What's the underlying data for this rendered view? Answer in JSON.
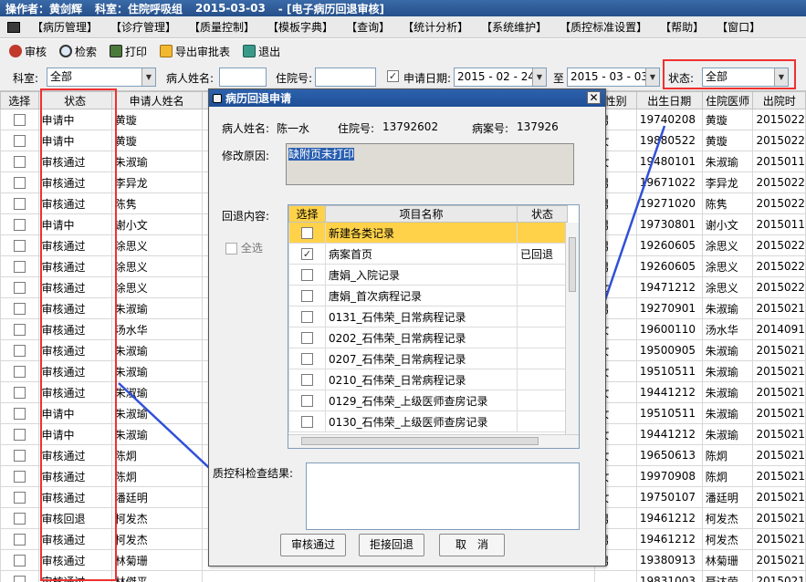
{
  "titlebar": {
    "operator": "操作者：黄剑辉",
    "department": "科室：住院呼吸组",
    "date": "2015-03-03",
    "window": "- [电子病历回退审核]"
  },
  "menu": [
    "【病历管理】",
    "【诊疗管理】",
    "【质量控制】",
    "【模板字典】",
    "【查询】",
    "【统计分析】",
    "【系统维护】",
    "【质控标准设置】",
    "【帮助】",
    "【窗口】"
  ],
  "toolbar": {
    "audit": "审核",
    "search": "检索",
    "print": "打印",
    "export": "导出审批表",
    "exit": "退出"
  },
  "filters": {
    "dept_label": "科室:",
    "dept_value": "全部",
    "patient_label": "病人姓名:",
    "patient_value": "",
    "admission_label": "住院号:",
    "admission_value": "",
    "date_label": "申请日期:",
    "date_from": "2015 - 02 - 24",
    "date_to_label": "至",
    "date_to": "2015 - 03 - 03",
    "status_label": "状态:",
    "status_value": "全部"
  },
  "grid": {
    "headers": [
      "选择",
      "状态",
      "申请人姓名",
      "性别",
      "出生日期",
      "住院医师",
      "出院时"
    ],
    "rows": [
      {
        "status": "申请中",
        "applicant": "黄璇",
        "sex": "男",
        "dob": "19740208",
        "doctor": "黄璇",
        "discharge": "2015022"
      },
      {
        "status": "申请中",
        "applicant": "黄璇",
        "sex": "女",
        "dob": "19880522",
        "doctor": "黄璇",
        "discharge": "2015022"
      },
      {
        "status": "审核通过",
        "applicant": "朱淑瑜",
        "sex": "女",
        "dob": "19480101",
        "doctor": "朱淑瑜",
        "discharge": "2015011"
      },
      {
        "status": "审核通过",
        "applicant": "李异龙",
        "sex": "男",
        "dob": "19671022",
        "doctor": "李异龙",
        "discharge": "2015022"
      },
      {
        "status": "审核通过",
        "applicant": "陈隽",
        "sex": "男",
        "dob": "19271020",
        "doctor": "陈隽",
        "discharge": "2015022"
      },
      {
        "status": "申请中",
        "applicant": "谢小文",
        "sex": "男",
        "dob": "19730801",
        "doctor": "谢小文",
        "discharge": "2015011"
      },
      {
        "status": "审核通过",
        "applicant": "涂思义",
        "sex": "男",
        "dob": "19260605",
        "doctor": "涂思义",
        "discharge": "2015022"
      },
      {
        "status": "审核通过",
        "applicant": "涂思义",
        "sex": "男",
        "dob": "19260605",
        "doctor": "涂思义",
        "discharge": "2015022"
      },
      {
        "status": "审核通过",
        "applicant": "涂思义",
        "sex": "女",
        "dob": "19471212",
        "doctor": "涂思义",
        "discharge": "2015022"
      },
      {
        "status": "审核通过",
        "applicant": "朱淑瑜",
        "sex": "男",
        "dob": "19270901",
        "doctor": "朱淑瑜",
        "discharge": "2015021"
      },
      {
        "status": "审核通过",
        "applicant": "汤水华",
        "sex": "女",
        "dob": "19600110",
        "doctor": "汤水华",
        "discharge": "2014091"
      },
      {
        "status": "审核通过",
        "applicant": "朱淑瑜",
        "sex": "女",
        "dob": "19500905",
        "doctor": "朱淑瑜",
        "discharge": "2015021"
      },
      {
        "status": "审核通过",
        "applicant": "朱淑瑜",
        "sex": "女",
        "dob": "19510511",
        "doctor": "朱淑瑜",
        "discharge": "2015021"
      },
      {
        "status": "审核通过",
        "applicant": "朱淑瑜",
        "sex": "女",
        "dob": "19441212",
        "doctor": "朱淑瑜",
        "discharge": "2015021"
      },
      {
        "status": "申请中",
        "applicant": "朱淑瑜",
        "sex": "女",
        "dob": "19510511",
        "doctor": "朱淑瑜",
        "discharge": "2015021"
      },
      {
        "status": "申请中",
        "applicant": "朱淑瑜",
        "sex": "女",
        "dob": "19441212",
        "doctor": "朱淑瑜",
        "discharge": "2015021"
      },
      {
        "status": "审核通过",
        "applicant": "陈炯",
        "sex": "女",
        "dob": "19650613",
        "doctor": "陈炯",
        "discharge": "2015021"
      },
      {
        "status": "审核通过",
        "applicant": "陈炯",
        "sex": "女",
        "dob": "19970908",
        "doctor": "陈炯",
        "discharge": "2015021"
      },
      {
        "status": "审核通过",
        "applicant": "潘廷明",
        "sex": "女",
        "dob": "19750107",
        "doctor": "潘廷明",
        "discharge": "2015021"
      },
      {
        "status": "审核回退",
        "applicant": "柯发杰",
        "sex": "男",
        "dob": "19461212",
        "doctor": "柯发杰",
        "discharge": "2015021"
      },
      {
        "status": "审核通过",
        "applicant": "柯发杰",
        "sex": "男",
        "dob": "19461212",
        "doctor": "柯发杰",
        "discharge": "2015021"
      },
      {
        "status": "审核通过",
        "applicant": "林菊珊",
        "sex": "男",
        "dob": "19380913",
        "doctor": "林菊珊",
        "discharge": "2015021"
      },
      {
        "status": "审核通过",
        "applicant": "林傑平",
        "sex": "",
        "dob": "19831003",
        "doctor": "聂达荣",
        "discharge": "2015021"
      }
    ]
  },
  "dialog": {
    "title": "病历回退申请",
    "patient_label": "病人姓名:",
    "patient_name": "陈一水",
    "admission_label": "住院号:",
    "admission_no": "13792602",
    "case_label": "病案号:",
    "case_no": "137926",
    "reason_label": "修改原因:",
    "reason_text": "缺附页未打印",
    "content_label": "回退内容:",
    "select_all": "全选",
    "item_headers": [
      "选择",
      "项目名称",
      "状态"
    ],
    "items": [
      {
        "name": "新建各类记录",
        "checked": false,
        "status": ""
      },
      {
        "name": "病案首页",
        "checked": true,
        "status": "已回退"
      },
      {
        "name": "唐娟_入院记录",
        "checked": false,
        "status": ""
      },
      {
        "name": "唐娟_首次病程记录",
        "checked": false,
        "status": ""
      },
      {
        "name": "0131_石伟荣_日常病程记录",
        "checked": false,
        "status": ""
      },
      {
        "name": "0202_石伟荣_日常病程记录",
        "checked": false,
        "status": ""
      },
      {
        "name": "0207_石伟荣_日常病程记录",
        "checked": false,
        "status": ""
      },
      {
        "name": "0210_石伟荣_日常病程记录",
        "checked": false,
        "status": ""
      },
      {
        "name": "0129_石伟荣_上级医师查房记录",
        "checked": false,
        "status": ""
      },
      {
        "name": "0130_石伟荣_上级医师查房记录",
        "checked": false,
        "status": ""
      }
    ],
    "result_label": "质控科检查结果:",
    "approve": "审核通过",
    "reject": "拒接回退",
    "cancel": "取　消"
  },
  "colors": {
    "title_bg": "#2f5fa5",
    "highlight_row": "#ffd24a",
    "annotation": "#f03030",
    "arrow": "#3050d8"
  }
}
